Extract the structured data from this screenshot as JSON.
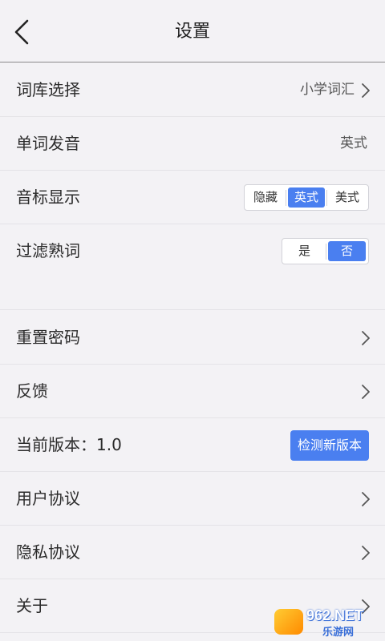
{
  "header": {
    "title": "设置"
  },
  "settings": {
    "vocab": {
      "label": "词库选择",
      "value": "小学词汇"
    },
    "pronunciation": {
      "label": "单词发音",
      "value": "英式"
    },
    "phonetic": {
      "label": "音标显示",
      "options": [
        "隐藏",
        "英式",
        "美式"
      ],
      "selected": "英式"
    },
    "filter": {
      "label": "过滤熟词",
      "options": [
        "是",
        "否"
      ],
      "selected": "否"
    }
  },
  "account": {
    "reset_password": {
      "label": "重置密码"
    },
    "feedback": {
      "label": "反馈"
    },
    "version": {
      "label": "当前版本：1.0",
      "button": "检测新版本"
    },
    "user_agreement": {
      "label": "用户协议"
    },
    "privacy": {
      "label": "隐私协议"
    },
    "about": {
      "label": "关于"
    }
  },
  "watermark": {
    "brand": "962.NET",
    "sub": "乐游网"
  },
  "colors": {
    "accent": "#4a7ff0",
    "background": "#f3f2f5"
  }
}
